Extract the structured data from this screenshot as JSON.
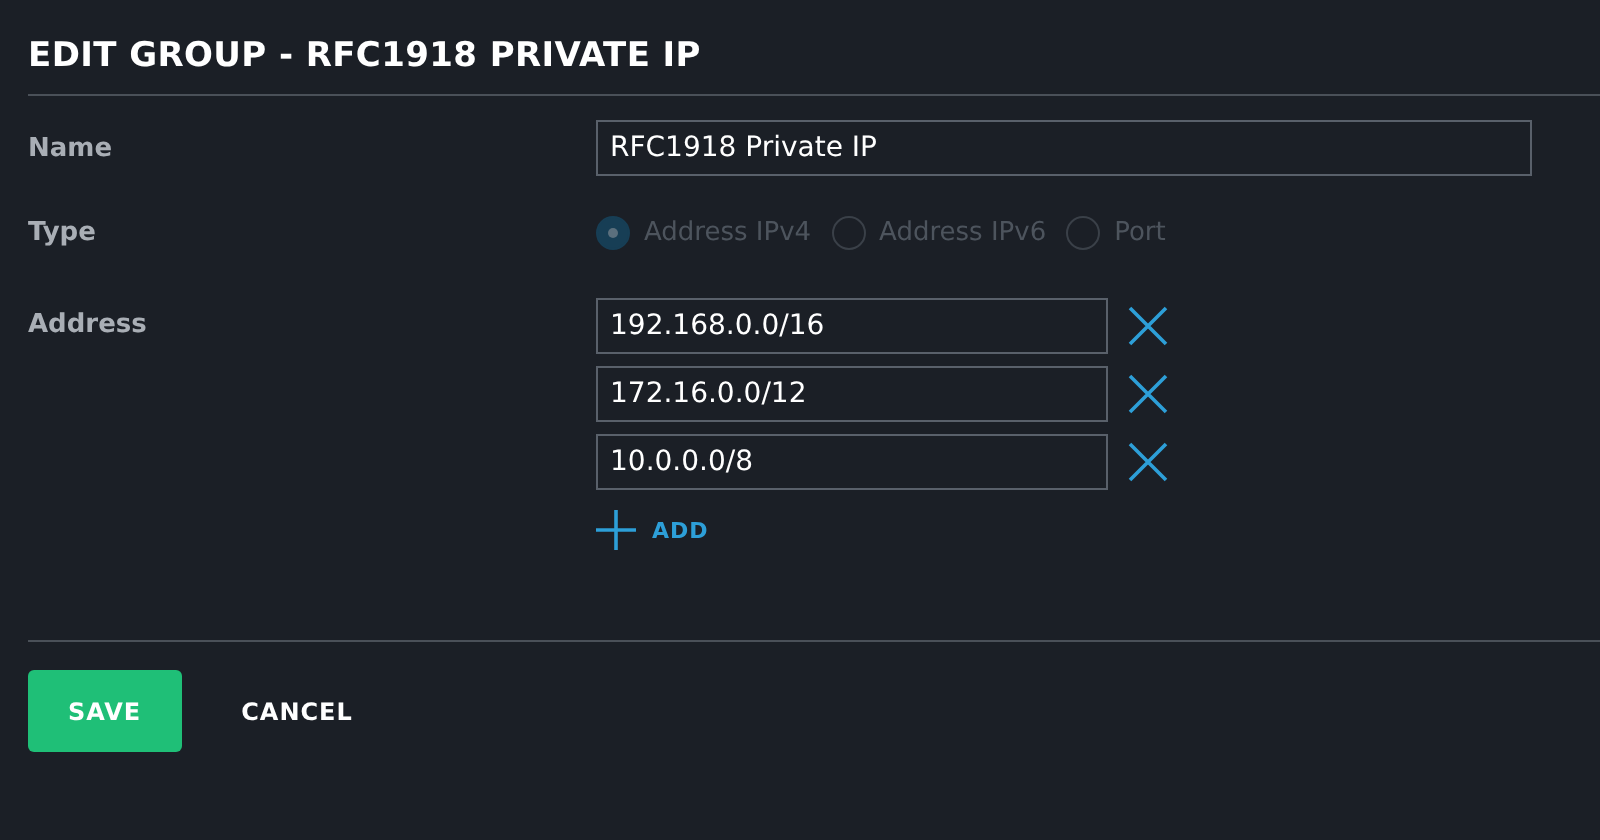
{
  "title": "EDIT GROUP - RFC1918 PRIVATE IP",
  "name_row": {
    "label": "Name",
    "value": "RFC1918 Private IP"
  },
  "type_row": {
    "label": "Type",
    "disabled": true,
    "options": [
      {
        "label": "Address IPv4",
        "selected": true
      },
      {
        "label": "Address IPv6",
        "selected": false
      },
      {
        "label": "Port",
        "selected": false
      }
    ]
  },
  "address_row": {
    "label": "Address",
    "addresses": [
      "192.168.0.0/16",
      "172.16.0.0/12",
      "10.0.0.0/8"
    ],
    "add_label": "ADD"
  },
  "buttons": [
    {
      "label": "SAVE",
      "kind": "primary"
    },
    {
      "label": "CANCEL",
      "kind": "plain"
    }
  ]
}
